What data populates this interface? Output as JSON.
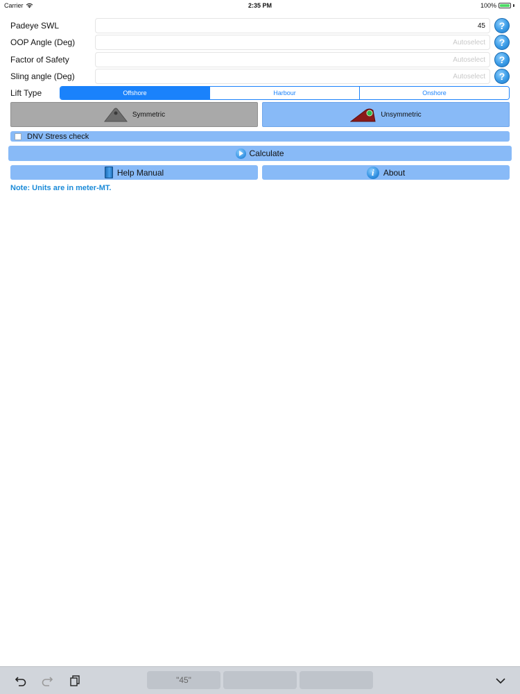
{
  "status_bar": {
    "carrier": "Carrier",
    "time": "2:35 PM",
    "battery": "100%",
    "battery_level": 1.0
  },
  "form": {
    "rows": [
      {
        "label": "Padeye SWL",
        "value": "45",
        "placeholder": ""
      },
      {
        "label": "OOP Angle (Deg)",
        "value": "",
        "placeholder": "Autoselect"
      },
      {
        "label": "Factor of Safety",
        "value": "",
        "placeholder": "Autoselect"
      },
      {
        "label": "Sling angle (Deg)",
        "value": "",
        "placeholder": "Autoselect"
      }
    ],
    "help_glyph": "?"
  },
  "lift_type": {
    "label": "Lift Type",
    "options": [
      "Offshore",
      "Harbour",
      "Onshore"
    ],
    "selected": "Offshore"
  },
  "type_buttons": {
    "symmetric": "Symmetric",
    "unsymmetric": "Unsymmetric"
  },
  "dnv": {
    "label": "DNV Stress check",
    "checked": false
  },
  "actions": {
    "calculate": "Calculate",
    "help_manual": "Help Manual",
    "about": "About",
    "info_glyph": "i"
  },
  "note": "Note: Units are in meter-MT.",
  "keyboard_bar": {
    "suggestion": "\"45\"",
    "undo_icon": "undo-icon",
    "redo_icon": "redo-icon",
    "clipboard_icon": "clipboard-icon",
    "dismiss_icon": "chevron-down-icon"
  },
  "colors": {
    "accent": "#1a82fb",
    "button_blue": "#88baf7",
    "button_gray": "#a9a9a9",
    "note_text": "#1a8ad8"
  }
}
